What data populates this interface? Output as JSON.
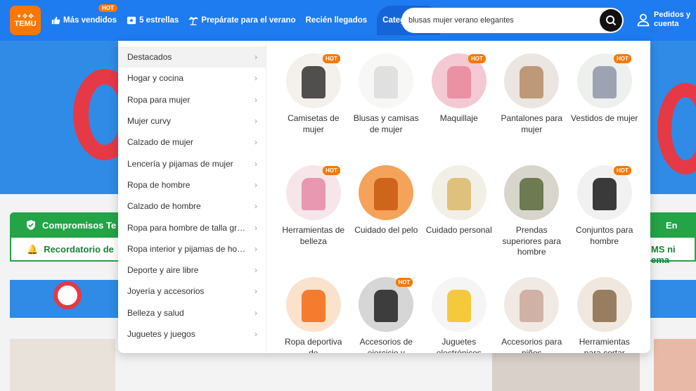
{
  "header": {
    "logo_glyphs": "✦✥✤",
    "logo_text": "TEMU",
    "nav": [
      {
        "label": "Más vendidos",
        "badge": "HOT"
      },
      {
        "label": "5 estrellas"
      },
      {
        "label": "Prepárate para el verano"
      },
      {
        "label": "Recién llegados"
      },
      {
        "label": "Categorías"
      }
    ],
    "search_value": "blusas mujer verano elegantes",
    "account_line1": "Pedidos y",
    "account_line2": "cuenta"
  },
  "background": {
    "strip1_text": "Compromisos Te",
    "strip1_right": "En",
    "strip2_text": "Recordatorio de",
    "strip2_right": "MS ni ema"
  },
  "categories": [
    "Destacados",
    "Hogar y cocina",
    "Ropa para mujer",
    "Mujer curvy",
    "Calzado de mujer",
    "Lencería y pijamas de mujer",
    "Ropa de hombre",
    "Calzado de hombre",
    "Ropa para hombre de talla grande",
    "Ropa interior y pijamas de hombre",
    "Deporte y aire libre",
    "Joyería y accesorios",
    "Belleza y salud",
    "Juguetes y juegos"
  ],
  "tiles": [
    {
      "label": "Camisetas de mujer",
      "hot": "HOT",
      "color": "#f4f1ec",
      "accent": "#333333"
    },
    {
      "label": "Blusas y camisas de mujer",
      "hot": "",
      "color": "#f7f7f5",
      "accent": "#dcdcdc"
    },
    {
      "label": "Maquillaje",
      "hot": "HOT",
      "color": "#f4c9d3",
      "accent": "#e8879b"
    },
    {
      "label": "Pantalones para mujer",
      "hot": "",
      "color": "#ebe6e1",
      "accent": "#b58a66"
    },
    {
      "label": "Vestidos de mujer",
      "hot": "HOT",
      "color": "#eef0ee",
      "accent": "#8e95a8"
    },
    {
      "label": "Herramientas de belleza",
      "hot": "HOT",
      "color": "#f6e6ea",
      "accent": "#e58aa7"
    },
    {
      "label": "Cuidado del pelo",
      "hot": "",
      "color": "#f4a35a",
      "accent": "#c85a12"
    },
    {
      "label": "Cuidado personal",
      "hot": "",
      "color": "#f2efe7",
      "accent": "#d9b86a"
    },
    {
      "label": "Prendas superiores para hombre",
      "hot": "",
      "color": "#d8d5cc",
      "accent": "#5b6a3c"
    },
    {
      "label": "Conjuntos para hombre",
      "hot": "HOT",
      "color": "#f1f1f1",
      "accent": "#1a1a1a"
    },
    {
      "label": "Ropa deportiva de",
      "hot": "",
      "color": "#fbe2cc",
      "accent": "#f36a13"
    },
    {
      "label": "Accesorios de ejercicio y",
      "hot": "HOT",
      "color": "#d6d6d6",
      "accent": "#222222"
    },
    {
      "label": "Juguetes electrónicos",
      "hot": "",
      "color": "#f5f5f5",
      "accent": "#f3c21b"
    },
    {
      "label": "Accesorios para niños",
      "hot": "",
      "color": "#f1e9e4",
      "accent": "#caa79a"
    },
    {
      "label": "Herramientas para cortar",
      "hot": "",
      "color": "#f0e8de",
      "accent": "#8a6a4a"
    }
  ]
}
